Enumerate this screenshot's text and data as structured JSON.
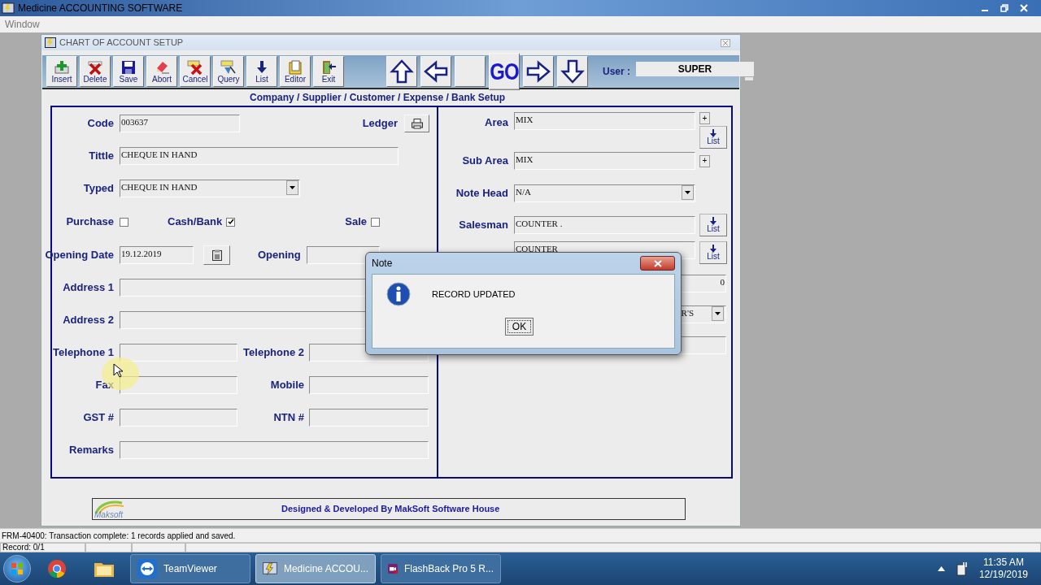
{
  "app_title": "Medicine ACCOUNTING SOFTWARE",
  "menu": [
    "Window"
  ],
  "form": {
    "title": "CHART OF ACCOUNT SETUP",
    "toolbar": [
      {
        "kind": "insert",
        "label": "Insert"
      },
      {
        "kind": "delete",
        "label": "Delete"
      },
      {
        "kind": "save",
        "label": "Save"
      },
      {
        "kind": "abort",
        "label": "Abort"
      },
      {
        "kind": "cancel",
        "label": "Cancel"
      },
      {
        "kind": "query",
        "label": "Query"
      },
      {
        "kind": "list",
        "label": "List"
      },
      {
        "kind": "editor",
        "label": "Editor"
      },
      {
        "kind": "exit",
        "label": "Exit"
      }
    ],
    "nav_buttons": [
      {
        "kind": "up"
      },
      {
        "kind": "left"
      },
      {
        "kind": "blank"
      },
      {
        "kind": "go",
        "label": "GO"
      },
      {
        "kind": "right"
      },
      {
        "kind": "down"
      }
    ],
    "user": {
      "label": "User :",
      "value": "SUPER"
    },
    "heading": "Company / Supplier / Customer / Expense / Bank Setup",
    "code": {
      "label": "Code",
      "value": "003637"
    },
    "ledger": {
      "label": "Ledger"
    },
    "tittle": {
      "label": "Tittle",
      "value": "CHEQUE IN HAND"
    },
    "typed": {
      "label": "Typed",
      "value": "CHEQUE IN HAND"
    },
    "checks": [
      {
        "label": "Purchase",
        "checked": false
      },
      {
        "label": "Cash/Bank",
        "checked": true
      },
      {
        "label": "Sale",
        "checked": false
      }
    ],
    "opening_date": {
      "label": "Opening Date",
      "value": "19.12.2019"
    },
    "opening": {
      "label": "Opening"
    },
    "address_1": {
      "label": "Address 1"
    },
    "address_2": {
      "label": "Address 2"
    },
    "telephone_1": {
      "label": "Telephone 1"
    },
    "telephone_2": {
      "label": "Telephone 2"
    },
    "fax": {
      "label": "Fax"
    },
    "mobile": {
      "label": "Mobile"
    },
    "gst": {
      "label": "GST #"
    },
    "ntn": {
      "label": "NTN #"
    },
    "remarks": {
      "label": "Remarks"
    },
    "area": {
      "label": "Area",
      "value": "MIX",
      "button": "+",
      "list": "List"
    },
    "sub_area": {
      "label": "Sub Area",
      "value": "MIX",
      "button": "+"
    },
    "note_head": {
      "label": "Note Head",
      "value": "N/A"
    },
    "salesman": {
      "label": "Salesman",
      "value": "COUNTER .",
      "list": "List"
    },
    "field_5": {
      "value": "COUNTER",
      "list": "List"
    },
    "field_6": {
      "value": "0"
    },
    "dropdown_7": {
      "value": "R'S"
    },
    "footer": {
      "logo": "Maksoft",
      "text": "Designed & Developed By MakSoft Software House"
    }
  },
  "dialog": {
    "title": "Note",
    "message": "RECORD UPDATED",
    "button": "OK"
  },
  "status": {
    "message": "FRM-40400: Transaction complete: 1 records applied and saved.",
    "record": "Record: 0/1"
  },
  "taskbar": {
    "items": [
      {
        "kind": "teamviewer",
        "label": "TeamViewer",
        "selected": false
      },
      {
        "kind": "app",
        "label": "Medicine ACCOU...",
        "selected": true
      },
      {
        "kind": "flashback",
        "label": "FlashBack Pro 5 R...",
        "selected": false
      }
    ],
    "time": "11:35 AM",
    "date": "12/19/2019"
  }
}
